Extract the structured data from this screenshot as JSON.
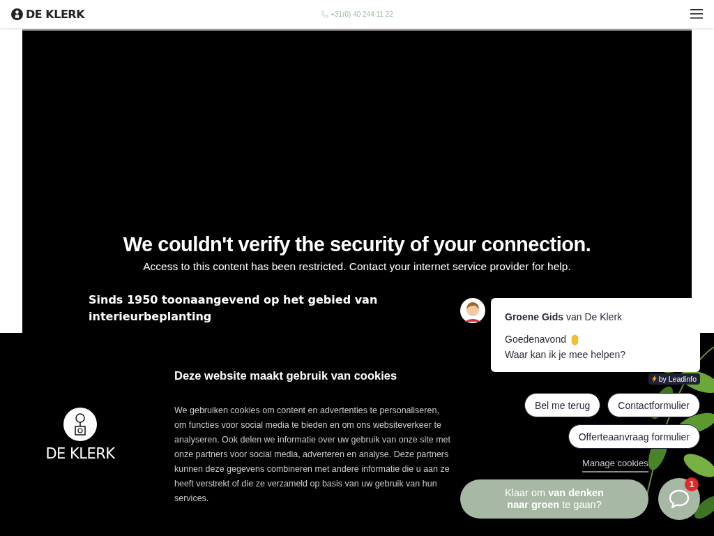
{
  "header": {
    "logo_text": "DE KLERK",
    "phone": "+31(0) 40 244 11 22"
  },
  "video_error": {
    "title": "We couldn't verify the security of your connection.",
    "message": "Access to this content has been restricted. Contact your internet service provider for help."
  },
  "hero": {
    "text": "Sinds 1950 toonaangevend op het gebied van interieurbeplanting"
  },
  "cookie_banner": {
    "logo_text": "DE KLERK",
    "title": "Deze website maakt gebruik van cookies",
    "body": "We gebruiken cookies om content en advertenties te personaliseren, om functies voor social media te bieden en om ons websiteverkeer te analyseren. Ook delen we informatie over uw gebruik van onze site met onze partners voor social media, adverteren en analyse. Deze partners kunnen deze gegevens combineren met andere informatie die u aan ze heeft verstrekt of die ze verzameld op basis van uw gebruik van hun services.",
    "manage_link": "Manage cookies"
  },
  "chat": {
    "agent_line": "**Groene Gids** van De Klerk",
    "greeting": "Goedenavond",
    "question": "Waar kan ik je mee helpen?",
    "powered_by": "by Leadinfo",
    "quick_replies": [
      {
        "label": "Bel me terug"
      },
      {
        "label": "Contactformulier"
      },
      {
        "label": "Offerteaanvraag formulier"
      }
    ],
    "cta": "Klaar om **van denken naar groen** te gaan?",
    "unread_badge": "1"
  }
}
